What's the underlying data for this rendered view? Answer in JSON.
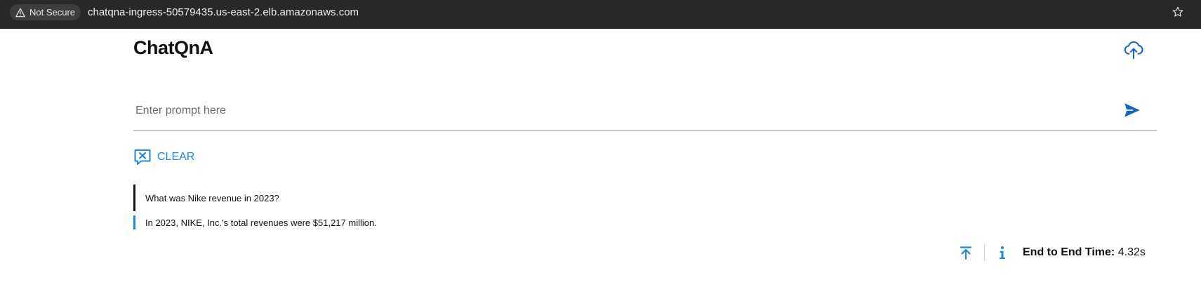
{
  "browser": {
    "security_label": "Not Secure",
    "url": "chatqna-ingress-50579435.us-east-2.elb.amazonaws.com"
  },
  "app": {
    "title": "ChatQnA"
  },
  "prompt": {
    "placeholder": "Enter prompt here",
    "value": ""
  },
  "actions": {
    "clear_label": "CLEAR"
  },
  "conversation": [
    {
      "role": "user",
      "text": "What was Nike revenue in 2023?"
    },
    {
      "role": "assistant",
      "text": "In 2023, NIKE, Inc.'s total revenues were $51,217 million."
    }
  ],
  "metrics": {
    "end_to_end_label": "End to End Time:",
    "end_to_end_value": "4.32s"
  },
  "colors": {
    "accent": "#1e88e5",
    "upload_icon": "#1565c0",
    "browser_bar": "#282828"
  },
  "icons": {
    "security": "warning-triangle-icon",
    "bookmark": "star-icon",
    "upload": "cloud-upload-icon",
    "send": "send-icon",
    "clear": "chat-clear-icon",
    "scroll_top": "arrow-up-to-line-icon",
    "info": "info-icon"
  }
}
